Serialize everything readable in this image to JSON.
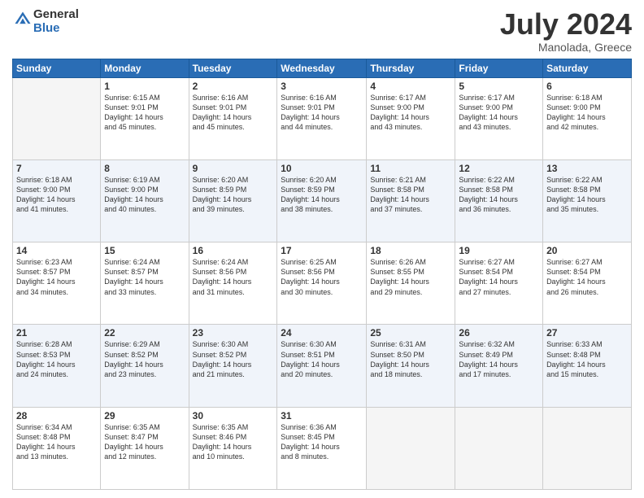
{
  "logo": {
    "text1": "General",
    "text2": "Blue"
  },
  "header": {
    "month_year": "July 2024",
    "location": "Manolada, Greece"
  },
  "days_of_week": [
    "Sunday",
    "Monday",
    "Tuesday",
    "Wednesday",
    "Thursday",
    "Friday",
    "Saturday"
  ],
  "weeks": [
    [
      {
        "day": "",
        "info": ""
      },
      {
        "day": "1",
        "info": "Sunrise: 6:15 AM\nSunset: 9:01 PM\nDaylight: 14 hours\nand 45 minutes."
      },
      {
        "day": "2",
        "info": "Sunrise: 6:16 AM\nSunset: 9:01 PM\nDaylight: 14 hours\nand 45 minutes."
      },
      {
        "day": "3",
        "info": "Sunrise: 6:16 AM\nSunset: 9:01 PM\nDaylight: 14 hours\nand 44 minutes."
      },
      {
        "day": "4",
        "info": "Sunrise: 6:17 AM\nSunset: 9:00 PM\nDaylight: 14 hours\nand 43 minutes."
      },
      {
        "day": "5",
        "info": "Sunrise: 6:17 AM\nSunset: 9:00 PM\nDaylight: 14 hours\nand 43 minutes."
      },
      {
        "day": "6",
        "info": "Sunrise: 6:18 AM\nSunset: 9:00 PM\nDaylight: 14 hours\nand 42 minutes."
      }
    ],
    [
      {
        "day": "7",
        "info": "Sunrise: 6:18 AM\nSunset: 9:00 PM\nDaylight: 14 hours\nand 41 minutes."
      },
      {
        "day": "8",
        "info": "Sunrise: 6:19 AM\nSunset: 9:00 PM\nDaylight: 14 hours\nand 40 minutes."
      },
      {
        "day": "9",
        "info": "Sunrise: 6:20 AM\nSunset: 8:59 PM\nDaylight: 14 hours\nand 39 minutes."
      },
      {
        "day": "10",
        "info": "Sunrise: 6:20 AM\nSunset: 8:59 PM\nDaylight: 14 hours\nand 38 minutes."
      },
      {
        "day": "11",
        "info": "Sunrise: 6:21 AM\nSunset: 8:58 PM\nDaylight: 14 hours\nand 37 minutes."
      },
      {
        "day": "12",
        "info": "Sunrise: 6:22 AM\nSunset: 8:58 PM\nDaylight: 14 hours\nand 36 minutes."
      },
      {
        "day": "13",
        "info": "Sunrise: 6:22 AM\nSunset: 8:58 PM\nDaylight: 14 hours\nand 35 minutes."
      }
    ],
    [
      {
        "day": "14",
        "info": "Sunrise: 6:23 AM\nSunset: 8:57 PM\nDaylight: 14 hours\nand 34 minutes."
      },
      {
        "day": "15",
        "info": "Sunrise: 6:24 AM\nSunset: 8:57 PM\nDaylight: 14 hours\nand 33 minutes."
      },
      {
        "day": "16",
        "info": "Sunrise: 6:24 AM\nSunset: 8:56 PM\nDaylight: 14 hours\nand 31 minutes."
      },
      {
        "day": "17",
        "info": "Sunrise: 6:25 AM\nSunset: 8:56 PM\nDaylight: 14 hours\nand 30 minutes."
      },
      {
        "day": "18",
        "info": "Sunrise: 6:26 AM\nSunset: 8:55 PM\nDaylight: 14 hours\nand 29 minutes."
      },
      {
        "day": "19",
        "info": "Sunrise: 6:27 AM\nSunset: 8:54 PM\nDaylight: 14 hours\nand 27 minutes."
      },
      {
        "day": "20",
        "info": "Sunrise: 6:27 AM\nSunset: 8:54 PM\nDaylight: 14 hours\nand 26 minutes."
      }
    ],
    [
      {
        "day": "21",
        "info": "Sunrise: 6:28 AM\nSunset: 8:53 PM\nDaylight: 14 hours\nand 24 minutes."
      },
      {
        "day": "22",
        "info": "Sunrise: 6:29 AM\nSunset: 8:52 PM\nDaylight: 14 hours\nand 23 minutes."
      },
      {
        "day": "23",
        "info": "Sunrise: 6:30 AM\nSunset: 8:52 PM\nDaylight: 14 hours\nand 21 minutes."
      },
      {
        "day": "24",
        "info": "Sunrise: 6:30 AM\nSunset: 8:51 PM\nDaylight: 14 hours\nand 20 minutes."
      },
      {
        "day": "25",
        "info": "Sunrise: 6:31 AM\nSunset: 8:50 PM\nDaylight: 14 hours\nand 18 minutes."
      },
      {
        "day": "26",
        "info": "Sunrise: 6:32 AM\nSunset: 8:49 PM\nDaylight: 14 hours\nand 17 minutes."
      },
      {
        "day": "27",
        "info": "Sunrise: 6:33 AM\nSunset: 8:48 PM\nDaylight: 14 hours\nand 15 minutes."
      }
    ],
    [
      {
        "day": "28",
        "info": "Sunrise: 6:34 AM\nSunset: 8:48 PM\nDaylight: 14 hours\nand 13 minutes."
      },
      {
        "day": "29",
        "info": "Sunrise: 6:35 AM\nSunset: 8:47 PM\nDaylight: 14 hours\nand 12 minutes."
      },
      {
        "day": "30",
        "info": "Sunrise: 6:35 AM\nSunset: 8:46 PM\nDaylight: 14 hours\nand 10 minutes."
      },
      {
        "day": "31",
        "info": "Sunrise: 6:36 AM\nSunset: 8:45 PM\nDaylight: 14 hours\nand 8 minutes."
      },
      {
        "day": "",
        "info": ""
      },
      {
        "day": "",
        "info": ""
      },
      {
        "day": "",
        "info": ""
      }
    ]
  ]
}
